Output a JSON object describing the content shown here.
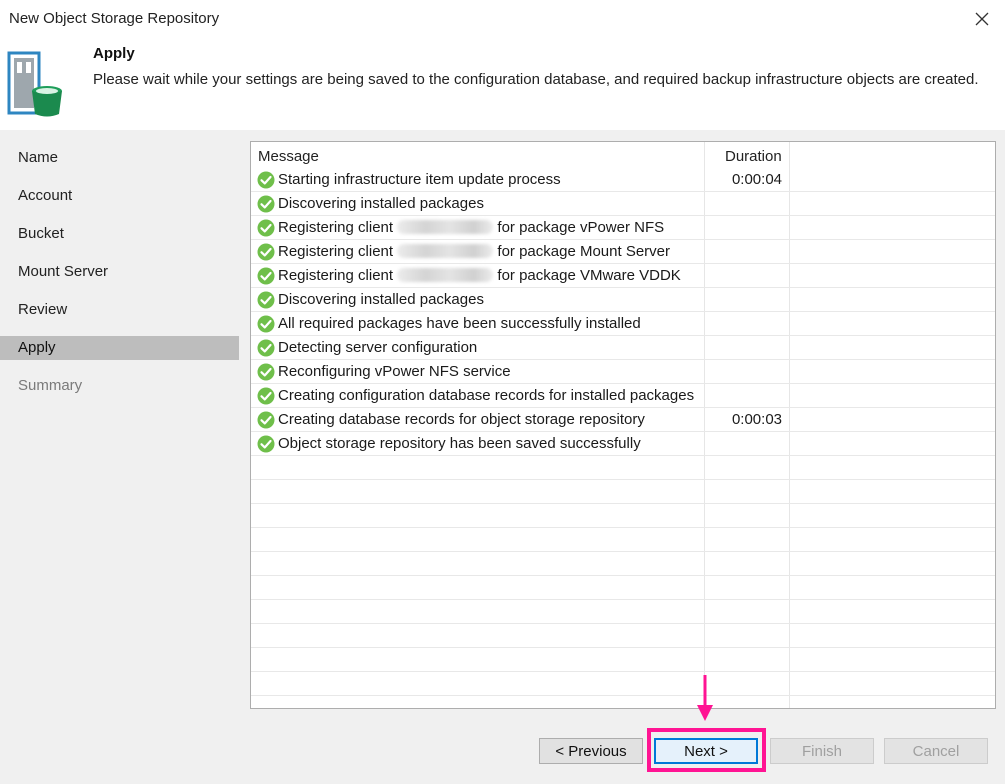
{
  "window": {
    "title": "New Object Storage Repository"
  },
  "header": {
    "title": "Apply",
    "description": "Please wait while your settings are being saved to the configuration database, and required backup infrastructure objects are created."
  },
  "sidebar": {
    "items": [
      {
        "label": "Name",
        "state": "normal"
      },
      {
        "label": "Account",
        "state": "normal"
      },
      {
        "label": "Bucket",
        "state": "normal"
      },
      {
        "label": "Mount Server",
        "state": "normal"
      },
      {
        "label": "Review",
        "state": "normal"
      },
      {
        "label": "Apply",
        "state": "active"
      },
      {
        "label": "Summary",
        "state": "disabled"
      }
    ]
  },
  "log": {
    "columns": {
      "message": "Message",
      "duration": "Duration"
    },
    "status_icon": "check-circle-icon",
    "status_color": "#6fbf4a",
    "rows": [
      {
        "pre": "Starting infrastructure item update process",
        "duration": "0:00:04"
      },
      {
        "pre": "Discovering installed packages",
        "duration": ""
      },
      {
        "pre": "Registering client",
        "redacted": true,
        "post": "for package vPower NFS",
        "duration": ""
      },
      {
        "pre": "Registering client",
        "redacted": true,
        "post": "for package Mount Server",
        "duration": ""
      },
      {
        "pre": "Registering client",
        "redacted": true,
        "post": "for package VMware VDDK",
        "duration": ""
      },
      {
        "pre": "Discovering installed packages",
        "duration": ""
      },
      {
        "pre": "All required packages have been successfully installed",
        "duration": ""
      },
      {
        "pre": "Detecting server configuration",
        "duration": ""
      },
      {
        "pre": "Reconfiguring vPower NFS service",
        "duration": ""
      },
      {
        "pre": "Creating configuration database records for installed packages",
        "duration": ""
      },
      {
        "pre": "Creating database records for object storage repository",
        "duration": "0:00:03"
      },
      {
        "pre": "Object storage repository has been saved successfully",
        "duration": ""
      }
    ]
  },
  "footer": {
    "previous_label": "< Previous",
    "next_label": "Next >",
    "finish_label": "Finish",
    "cancel_label": "Cancel"
  },
  "annotation": {
    "color": "#ff1493"
  }
}
